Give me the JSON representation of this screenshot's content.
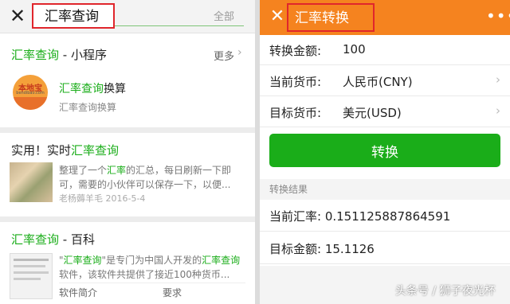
{
  "left": {
    "search": {
      "query": "汇率查询",
      "scope": "全部"
    },
    "miniprogram_section": {
      "title_highlight": "汇率查询",
      "title_rest": " - 小程序",
      "more": "更多",
      "item": {
        "logo_text": "本地宝",
        "logo_sub": "bendibao.com",
        "name_highlight": "汇率查询",
        "name_rest": "换算",
        "subtitle": "汇率查询换算"
      }
    },
    "article": {
      "title_prefix": "实用！实时",
      "title_highlight": "汇率查询",
      "desc_part1": "整理了一个",
      "desc_highlight": "汇率",
      "desc_part2": "的汇总，每日刷新一下即可，需要的小伙伴可以保存一下，以便...",
      "meta": "老杨薅羊毛  2016-5-4"
    },
    "baike_section": {
      "title_highlight": "汇率查询",
      "title_rest": " - 百科",
      "desc_q1": "\"",
      "desc_highlight1": "汇率查询",
      "desc_part2": "\"是专门为中国人开发的",
      "desc_highlight2": "汇率查询",
      "desc_part3": "软件，该软件共提供了接近100种货币...",
      "tab1": "软件简介",
      "tab2": "要求"
    }
  },
  "right": {
    "app_title": "汇率转换",
    "amount_label": "转换金额:",
    "amount_value": "100",
    "current_label": "当前货币:",
    "current_value": "人民币(CNY)",
    "target_label": "目标货币:",
    "target_value": "美元(USD)",
    "convert_button": "转换",
    "result_header": "转换结果",
    "rate_text": "当前汇率: 0.151125887864591",
    "amount_text": "目标金额: 15.1126"
  },
  "watermark": "头条号 / 狮子夜光杯",
  "icons": {
    "close": "close-icon",
    "chevron": "chevron-right-icon",
    "more": "more-dots-icon"
  },
  "colors": {
    "accent_green": "#1aad19",
    "appbar_orange": "#f5831f",
    "highlight_box": "#e0262c"
  }
}
